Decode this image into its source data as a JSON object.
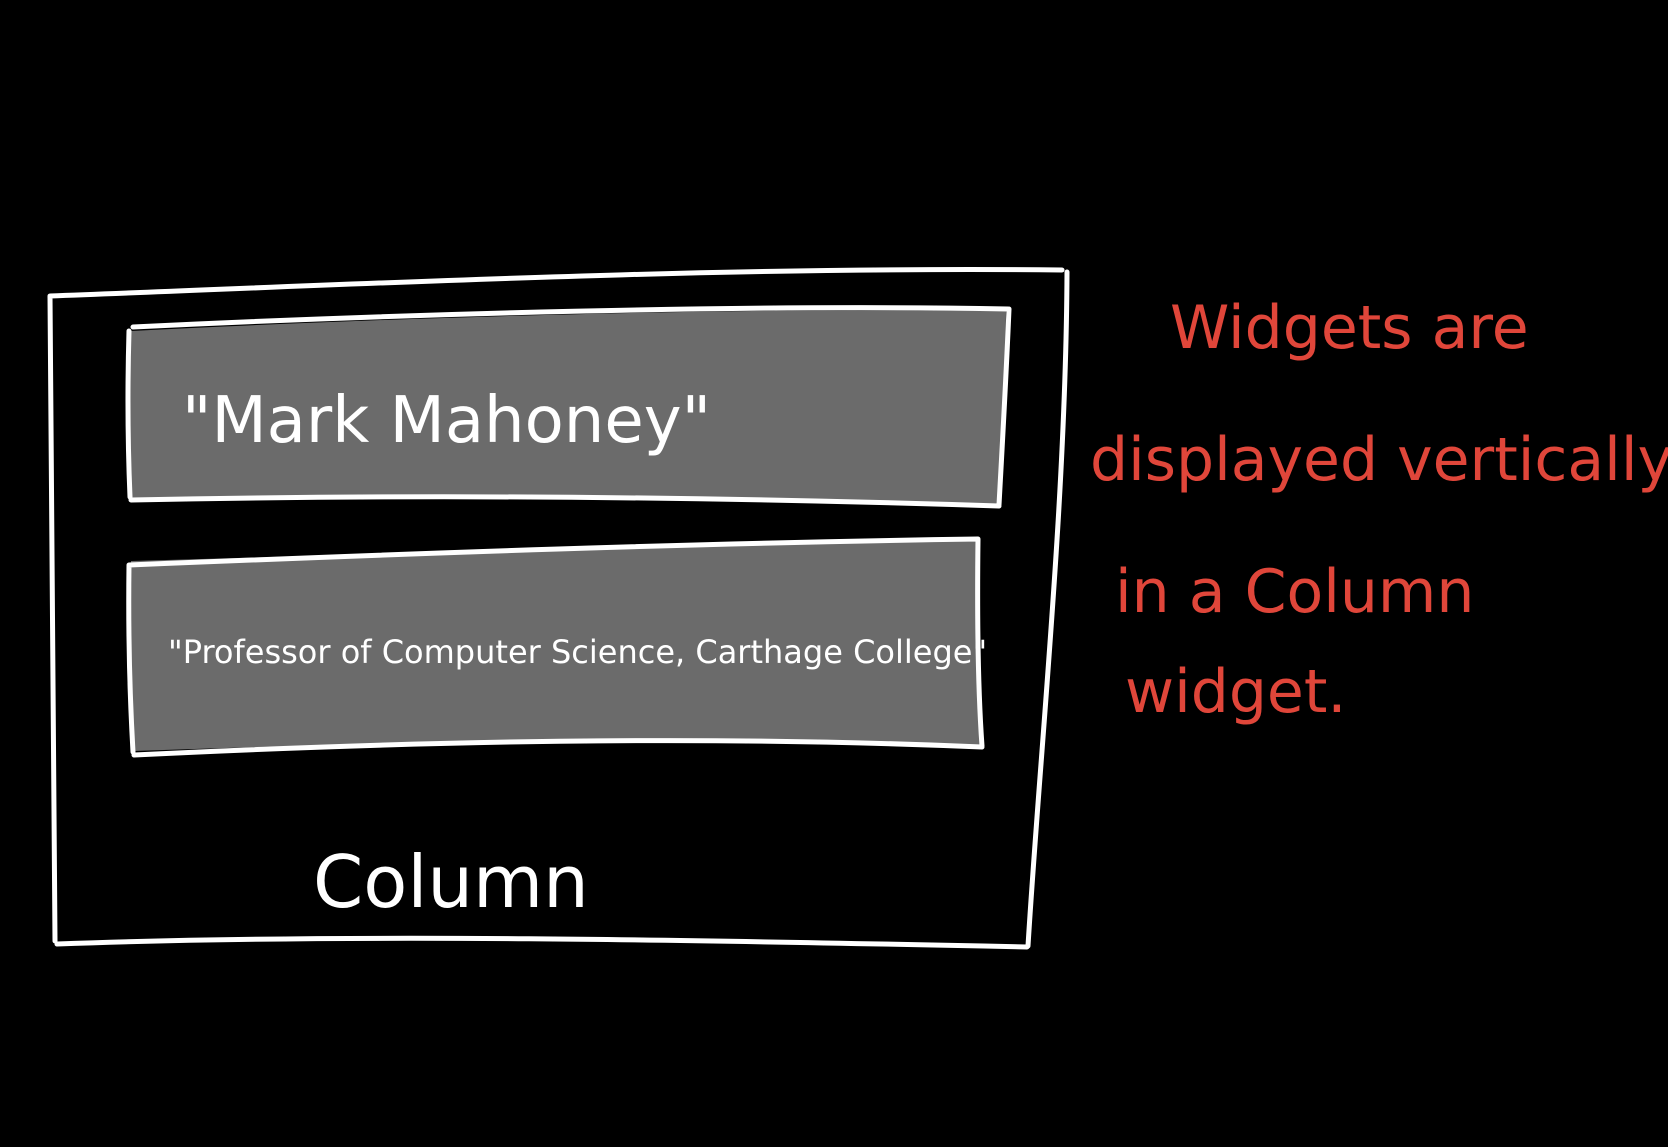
{
  "canvas": {
    "background": "#000000"
  },
  "colors": {
    "outline": "#ffffff",
    "box_fill": "#6b6b6b",
    "label": "#ffffff",
    "annotation": "#e0463a"
  },
  "column": {
    "label": "Column",
    "children": [
      {
        "text": "\"Mark  Mahoney\""
      },
      {
        "text": "\"Professor of Computer Science, Carthage College\""
      }
    ]
  },
  "annotation": {
    "lines": [
      "Widgets are",
      "displayed vertically",
      "in a Column",
      "widget."
    ]
  }
}
